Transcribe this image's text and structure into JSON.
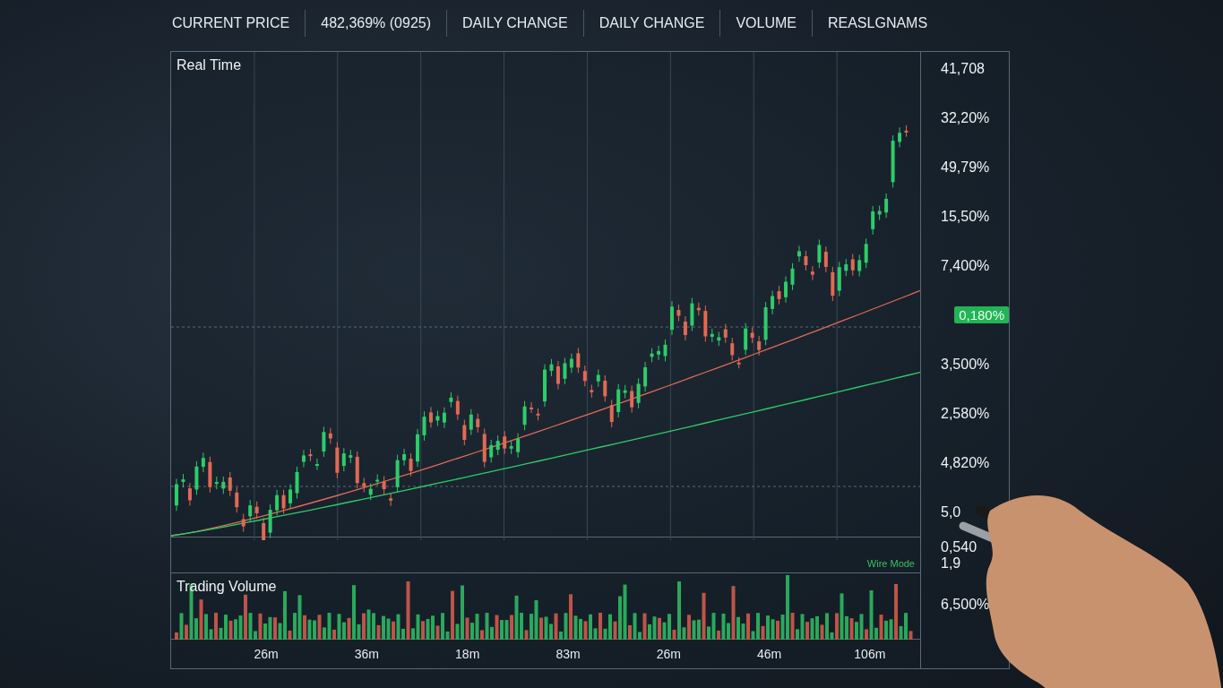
{
  "header": {
    "items": [
      "CURRENT PRICE",
      "482,369% (0925)",
      "DAILY CHANGE",
      "DAILY CHANGE",
      "VOLUME",
      "REASLGNAMS"
    ]
  },
  "chart": {
    "title": "Real Time",
    "mode_label": "Wire Mode",
    "volume_title": "Trading Volume",
    "axis_labels": [
      {
        "kind": "label",
        "text": "41,708"
      },
      {
        "kind": "label",
        "text": "32,20%"
      },
      {
        "kind": "label",
        "text": "49,79%"
      },
      {
        "kind": "label",
        "text": "15,50%"
      },
      {
        "kind": "label",
        "text": "7,400%"
      },
      {
        "kind": "badge",
        "text": "0,180%"
      },
      {
        "kind": "label",
        "text": "3,500%"
      },
      {
        "kind": "label",
        "text": "2,580%"
      },
      {
        "kind": "label",
        "text": "4,820%"
      },
      {
        "kind": "label",
        "text": "5,0"
      }
    ],
    "strip_labels": [
      "0,540",
      "1,9"
    ],
    "volume_labels": [
      "6,500%"
    ],
    "time_labels": [
      "26m",
      "36m",
      "18m",
      "83m",
      "26m",
      "46m",
      "106m"
    ]
  }
}
